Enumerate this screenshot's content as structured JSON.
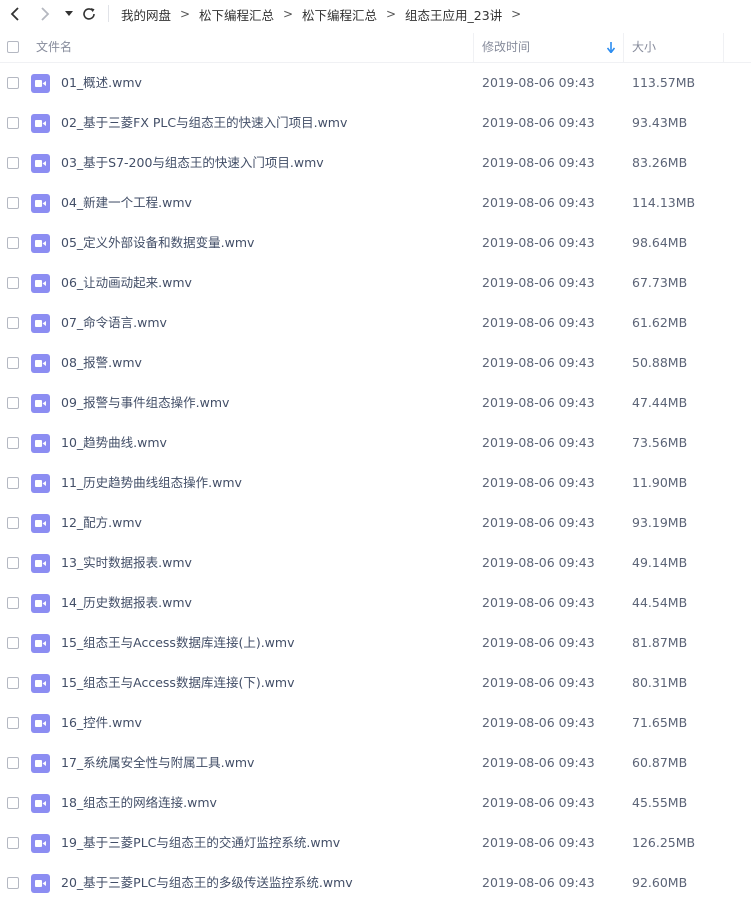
{
  "breadcrumb": [
    "我的网盘",
    "松下编程汇总",
    "松下编程汇总",
    "组态王应用_23讲"
  ],
  "breadcrumb_separator": ">",
  "columns": {
    "name": "文件名",
    "modified": "修改时间",
    "size": "大小"
  },
  "colors": {
    "accent": "#2b8cf0",
    "file_icon": "#8c8df2"
  },
  "files": [
    {
      "name": "01_概述.wmv",
      "modified": "2019-08-06 09:43",
      "size": "113.57MB"
    },
    {
      "name": "02_基于三菱FX PLC与组态王的快速入门项目.wmv",
      "modified": "2019-08-06 09:43",
      "size": "93.43MB"
    },
    {
      "name": "03_基于S7-200与组态王的快速入门项目.wmv",
      "modified": "2019-08-06 09:43",
      "size": "83.26MB"
    },
    {
      "name": "04_新建一个工程.wmv",
      "modified": "2019-08-06 09:43",
      "size": "114.13MB"
    },
    {
      "name": "05_定义外部设备和数据变量.wmv",
      "modified": "2019-08-06 09:43",
      "size": "98.64MB"
    },
    {
      "name": "06_让动画动起来.wmv",
      "modified": "2019-08-06 09:43",
      "size": "67.73MB"
    },
    {
      "name": "07_命令语言.wmv",
      "modified": "2019-08-06 09:43",
      "size": "61.62MB"
    },
    {
      "name": "08_报警.wmv",
      "modified": "2019-08-06 09:43",
      "size": "50.88MB"
    },
    {
      "name": "09_报警与事件组态操作.wmv",
      "modified": "2019-08-06 09:43",
      "size": "47.44MB"
    },
    {
      "name": "10_趋势曲线.wmv",
      "modified": "2019-08-06 09:43",
      "size": "73.56MB"
    },
    {
      "name": "11_历史趋势曲线组态操作.wmv",
      "modified": "2019-08-06 09:43",
      "size": "11.90MB"
    },
    {
      "name": "12_配方.wmv",
      "modified": "2019-08-06 09:43",
      "size": "93.19MB"
    },
    {
      "name": "13_实时数据报表.wmv",
      "modified": "2019-08-06 09:43",
      "size": "49.14MB"
    },
    {
      "name": "14_历史数据报表.wmv",
      "modified": "2019-08-06 09:43",
      "size": "44.54MB"
    },
    {
      "name": "15_组态王与Access数据库连接(上).wmv",
      "modified": "2019-08-06 09:43",
      "size": "81.87MB"
    },
    {
      "name": "15_组态王与Access数据库连接(下).wmv",
      "modified": "2019-08-06 09:43",
      "size": "80.31MB"
    },
    {
      "name": "16_控件.wmv",
      "modified": "2019-08-06 09:43",
      "size": "71.65MB"
    },
    {
      "name": "17_系统属安全性与附属工具.wmv",
      "modified": "2019-08-06 09:43",
      "size": "60.87MB"
    },
    {
      "name": "18_组态王的网络连接.wmv",
      "modified": "2019-08-06 09:43",
      "size": "45.55MB"
    },
    {
      "name": "19_基于三菱PLC与组态王的交通灯监控系统.wmv",
      "modified": "2019-08-06 09:43",
      "size": "126.25MB"
    },
    {
      "name": "20_基于三菱PLC与组态王的多级传送监控系统.wmv",
      "modified": "2019-08-06 09:43",
      "size": "92.60MB"
    }
  ]
}
